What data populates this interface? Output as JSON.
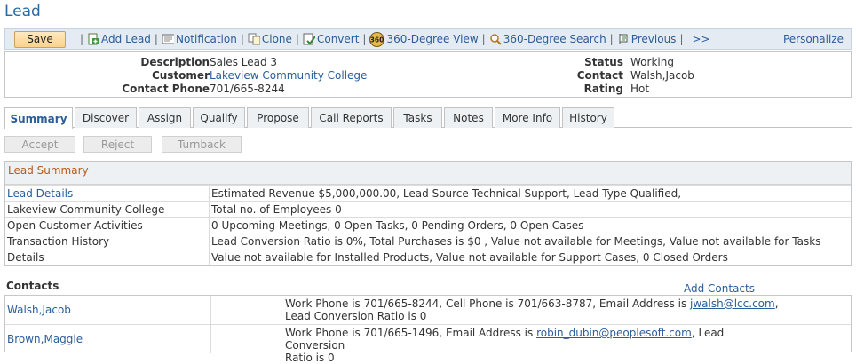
{
  "page": {
    "title": "Lead"
  },
  "toolbar": {
    "save_label": "Save",
    "items": [
      {
        "label": "Add Lead",
        "icon": "add-lead-icon"
      },
      {
        "label": "Notification",
        "icon": "notification-icon"
      },
      {
        "label": "Clone",
        "icon": "clone-icon"
      },
      {
        "label": "Convert",
        "icon": "convert-icon"
      },
      {
        "label": "360-Degree View",
        "icon": "360-icon"
      },
      {
        "label": "360-Degree Search",
        "icon": "search-icon"
      },
      {
        "label": "Previous",
        "icon": "previous-icon"
      }
    ],
    "more_label": ">>",
    "personalize_label": "Personalize",
    "icon_badge_text": "360"
  },
  "header": {
    "description_label": "Description",
    "description_value": "Sales Lead 3",
    "customer_label": "Customer",
    "customer_value": "Lakeview Community College",
    "phone_label": "Contact Phone",
    "phone_value": "701/665-8244",
    "status_label": "Status",
    "status_value": "Working",
    "contact_label": "Contact",
    "contact_value": "Walsh,Jacob",
    "rating_label": "Rating",
    "rating_value": "Hot"
  },
  "tabs": [
    "Summary",
    "Discover",
    "Assign",
    "Qualify",
    "Propose",
    "Call Reports",
    "Tasks",
    "Notes",
    "More Info",
    "History"
  ],
  "actions": {
    "accept": "Accept",
    "reject": "Reject",
    "turnback": "Turnback"
  },
  "summary": {
    "title": "Lead Summary",
    "rows": [
      {
        "label": "Lead Details",
        "value": "Estimated Revenue $5,000,000.00,  Lead Source Technical Support,  Lead Type Qualified,"
      },
      {
        "label": "Lakeview Community College",
        "value": "Total no. of Employees 0"
      },
      {
        "label": "Open Customer Activities",
        "value": "0 Upcoming Meetings, 0 Open Tasks, 0 Pending Orders, 0 Open Cases"
      },
      {
        "label": "Transaction History",
        "value": "Lead Conversion Ratio is 0%, Total Purchases is $0 , Value not available for Meetings, Value not available for Tasks"
      },
      {
        "label": "Details",
        "value": "Value not available for Installed Products, Value not available for Support Cases, 0 Closed Orders"
      }
    ]
  },
  "contacts": {
    "title": "Contacts",
    "add_label": "Add Contacts",
    "rows": [
      {
        "name": "Walsh,Jacob",
        "info_pre": "Work Phone is 701/665-8244, Cell Phone is 701/663-8787, Email Address is ",
        "email": "jwalsh@lcc.com",
        "info_post": ",",
        "info_line2": "Lead Conversion Ratio is 0"
      },
      {
        "name": "Brown,Maggie",
        "info_pre": "Work Phone is 701/665-1496, Email Address is ",
        "email": "robin_dubin@peoplesoft.com",
        "info_post": ", Lead Conversion",
        "info_line2": "Ratio is 0"
      }
    ]
  }
}
